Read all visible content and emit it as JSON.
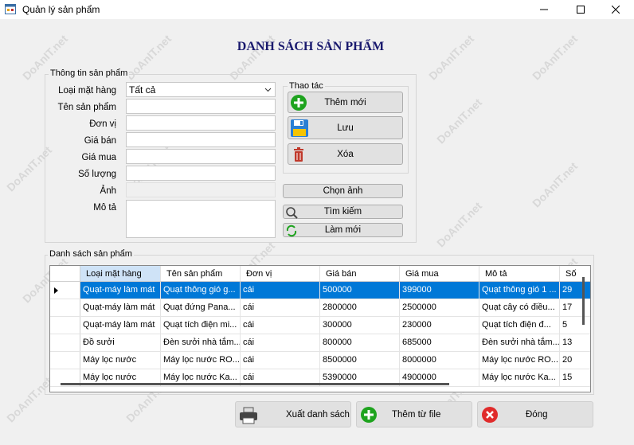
{
  "window": {
    "title": "Quản lý sản phẩm",
    "minimize_icon": "minimize-icon",
    "maximize_icon": "maximize-icon",
    "close_icon": "close-icon"
  },
  "heading": "DANH SÁCH SẢN PHẨM",
  "watermark": "DoAnIT.net",
  "info": {
    "legend": "Thông tin sản phẩm",
    "fields": [
      {
        "label": "Loại mặt hàng",
        "value": "Tất cả"
      },
      {
        "label": "Tên sản phẩm",
        "value": ""
      },
      {
        "label": "Đơn vị",
        "value": ""
      },
      {
        "label": "Giá bán",
        "value": ""
      },
      {
        "label": "Giá mua",
        "value": ""
      },
      {
        "label": "Số lượng",
        "value": ""
      },
      {
        "label": "Ảnh",
        "value": ""
      },
      {
        "label": "Mô tả",
        "value": ""
      }
    ]
  },
  "actions": {
    "legend": "Thao tác",
    "add": "Thêm mới",
    "save": "Lưu",
    "delete": "Xóa",
    "choose_image": "Chọn ảnh",
    "search": "Tìm kiếm",
    "refresh": "Làm mới"
  },
  "grid": {
    "legend": "Danh sách sản phẩm",
    "columns": [
      "Loại mặt hàng",
      "Tên sản phẩm",
      "Đơn vị",
      "Giá bán",
      "Giá mua",
      "Mô tả",
      "Số"
    ],
    "rows": [
      [
        "Quạt-máy làm mát",
        "Quạt thông gió g...",
        "cái",
        "500000",
        "399000",
        "Quạt thông gió 1 ...",
        "29"
      ],
      [
        "Quạt-máy làm mát",
        "Quạt đứng Pana...",
        "cái",
        "2800000",
        "2500000",
        "Quạt cây có điều...",
        "17"
      ],
      [
        "Quạt-máy làm mát",
        "Quạt tích điện mi...",
        "cái",
        "300000",
        "230000",
        "Quạt tích điện đ...",
        "5"
      ],
      [
        "Đồ sưởi",
        "Đèn sưởi nhà tắm...",
        "cái",
        "800000",
        "685000",
        "Đèn sưởi nhà tắm...",
        "13"
      ],
      [
        "Máy lọc nước",
        "Máy lọc nước RO...",
        "cái",
        "8500000",
        "8000000",
        "Máy lọc nước RO...",
        "20"
      ],
      [
        "Máy lọc nước",
        "Máy lọc nước Ka...",
        "cái",
        "5390000",
        "4900000",
        "Máy lọc nước Ka...",
        "15"
      ]
    ],
    "selected_row": 0
  },
  "footer": {
    "export": "Xuất danh sách",
    "import": "Thêm từ file",
    "close": "Đóng"
  },
  "colors": {
    "selection": "#0078d7",
    "heading": "#1a1a6e",
    "add_icon": "#1ea31e",
    "close_icon": "#e02b2b"
  }
}
